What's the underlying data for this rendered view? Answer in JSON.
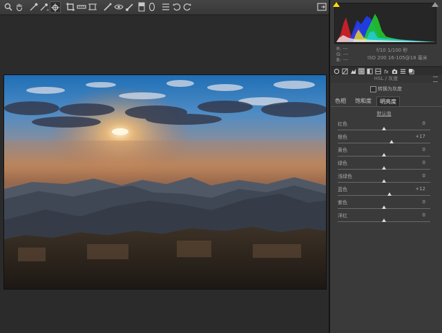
{
  "toolbar": {
    "left_icons": [
      "zoom-icon",
      "hand-icon",
      "white-balance-icon",
      "color-sampler-icon",
      "target-adjust-icon",
      "crop-icon",
      "straighten-icon",
      "transform-icon",
      "spot-removal-icon",
      "red-eye-icon",
      "adjustment-brush-icon",
      "graduated-filter-icon",
      "radial-filter-icon",
      "preferences-icon",
      "rotate-left-icon",
      "rotate-right-icon"
    ],
    "right_icon": "fullscreen-icon"
  },
  "histogram": {
    "rgb_r": "R:  ---",
    "rgb_g": "G:  ---",
    "rgb_b": "B:  ---",
    "aperture_shutter": "f/10   1/100 秒",
    "iso_lens": "ISO 200   16-105@18 毫米",
    "colors": {
      "red": "#e0202a",
      "green": "#20d030",
      "blue": "#2040ff",
      "yellow": "#f0e020",
      "magenta": "#e020e0",
      "cyan": "#20d0e0",
      "white": "#e6e6e6"
    }
  },
  "panel_tabs": [
    "basic-icon",
    "tone-curve-icon",
    "detail-icon",
    "hsl-icon",
    "split-toning-icon",
    "lens-icon",
    "effects-icon",
    "camera-calibration-icon",
    "presets-icon",
    "snapshots-icon"
  ],
  "section": {
    "title": "HSL / 灰度",
    "convert_label": "转换为灰度",
    "convert_checked": false
  },
  "subtabs": {
    "hue": "色相",
    "saturation": "饱和度",
    "luminance": "明亮度",
    "active": "明亮度"
  },
  "default_link": "默认值",
  "sliders": [
    {
      "label": "红色",
      "value": "0",
      "min": -100,
      "max": 100,
      "num": 0
    },
    {
      "label": "橙色",
      "value": "+17",
      "min": -100,
      "max": 100,
      "num": 17
    },
    {
      "label": "黄色",
      "value": "0",
      "min": -100,
      "max": 100,
      "num": 0
    },
    {
      "label": "绿色",
      "value": "0",
      "min": -100,
      "max": 100,
      "num": 0
    },
    {
      "label": "浅绿色",
      "value": "0",
      "min": -100,
      "max": 100,
      "num": 0
    },
    {
      "label": "蓝色",
      "value": "+12",
      "min": -100,
      "max": 100,
      "num": 12
    },
    {
      "label": "紫色",
      "value": "0",
      "min": -100,
      "max": 100,
      "num": 0
    },
    {
      "label": "洋红",
      "value": "0",
      "min": -100,
      "max": 100,
      "num": 0
    }
  ]
}
